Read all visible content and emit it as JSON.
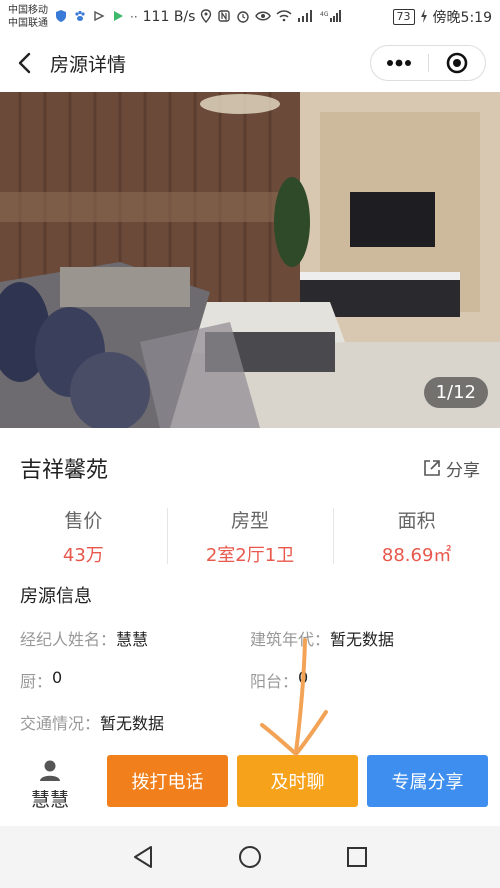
{
  "status_bar": {
    "carrier1": "中国移动",
    "carrier2": "中国联通",
    "speed": "111 B/s",
    "battery": "73",
    "time": "傍晚5:19"
  },
  "header": {
    "title": "房源详情"
  },
  "gallery": {
    "counter": "1/12"
  },
  "property": {
    "name": "吉祥馨苑",
    "share_label": "分享"
  },
  "stats": [
    {
      "label": "售价",
      "value": "43万"
    },
    {
      "label": "房型",
      "value": "2室2厅1卫"
    },
    {
      "label": "面积",
      "value": "88.69㎡"
    }
  ],
  "section": {
    "title": "房源信息"
  },
  "info": {
    "agent_label": "经纪人姓名：",
    "agent_value": "慧慧",
    "year_label": "建筑年代：",
    "year_value": "暂无数据",
    "kitchen_label": "厨：",
    "kitchen_value": "0",
    "balcony_label": "阳台：",
    "balcony_value": "0",
    "traffic_label": "交通情况：",
    "traffic_value": "暂无数据"
  },
  "actions": {
    "agent_name": "慧慧",
    "call": "拨打电话",
    "chat": "及时聊",
    "share": "专属分享"
  },
  "colors": {
    "price_red": "#e8584c",
    "call_orange": "#f07f1c",
    "chat_orange": "#f7a21b",
    "share_blue": "#3e8ef0",
    "annotation_arrow": "#f2a356"
  }
}
